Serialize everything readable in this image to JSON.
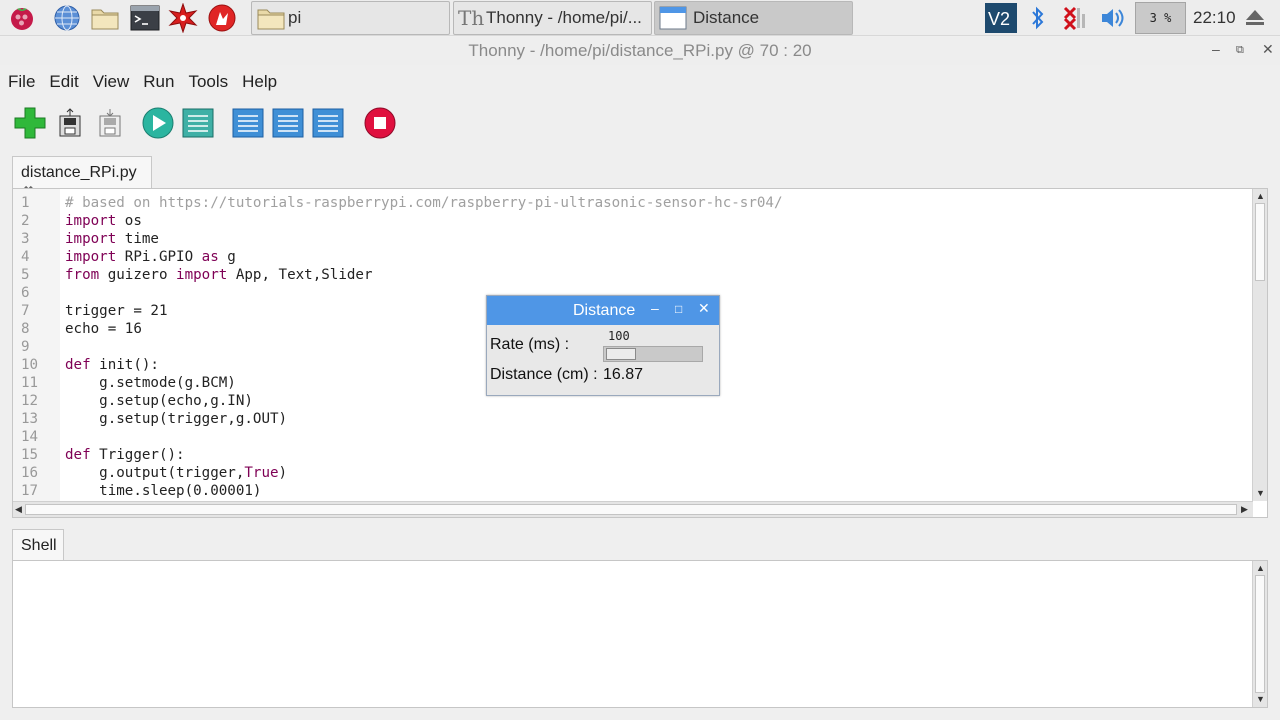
{
  "taskbar": {
    "tasks": [
      {
        "label": "pi"
      },
      {
        "label": "Thonny  -  /home/pi/..."
      },
      {
        "label": "Distance"
      }
    ],
    "tray": {
      "cpu": "3 %",
      "clock": "22:10"
    }
  },
  "window": {
    "title": "Thonny  -  /home/pi/distance_RPi.py  @  70 : 20"
  },
  "menu": [
    "File",
    "Edit",
    "View",
    "Run",
    "Tools",
    "Help"
  ],
  "editor": {
    "tab": "distance_RPi.py",
    "lines": [
      {
        "n": "1",
        "t": "# based on https://tutorials-raspberrypi.com/raspberry-pi-ultrasonic-sensor-hc-sr04/"
      },
      {
        "n": "2",
        "t": "import os"
      },
      {
        "n": "3",
        "t": "import time"
      },
      {
        "n": "4",
        "t": "import RPi.GPIO as g"
      },
      {
        "n": "5",
        "t": "from guizero import App, Text,Slider"
      },
      {
        "n": "6",
        "t": ""
      },
      {
        "n": "7",
        "t": "trigger = 21"
      },
      {
        "n": "8",
        "t": "echo = 16"
      },
      {
        "n": "9",
        "t": ""
      },
      {
        "n": "10",
        "t": "def init():"
      },
      {
        "n": "11",
        "t": "    g.setmode(g.BCM)"
      },
      {
        "n": "12",
        "t": "    g.setup(echo,g.IN)"
      },
      {
        "n": "13",
        "t": "    g.setup(trigger,g.OUT)"
      },
      {
        "n": "14",
        "t": ""
      },
      {
        "n": "15",
        "t": "def Trigger():"
      },
      {
        "n": "16",
        "t": "    g.output(trigger,True)"
      },
      {
        "n": "17",
        "t": "    time.sleep(0.00001)"
      }
    ]
  },
  "shell": {
    "tab": "Shell"
  },
  "distance_window": {
    "title": "Distance",
    "rate_label": "Rate (ms) :",
    "rate_value": "100",
    "distance_label": "Distance (cm) :",
    "distance_value": "16.87"
  }
}
